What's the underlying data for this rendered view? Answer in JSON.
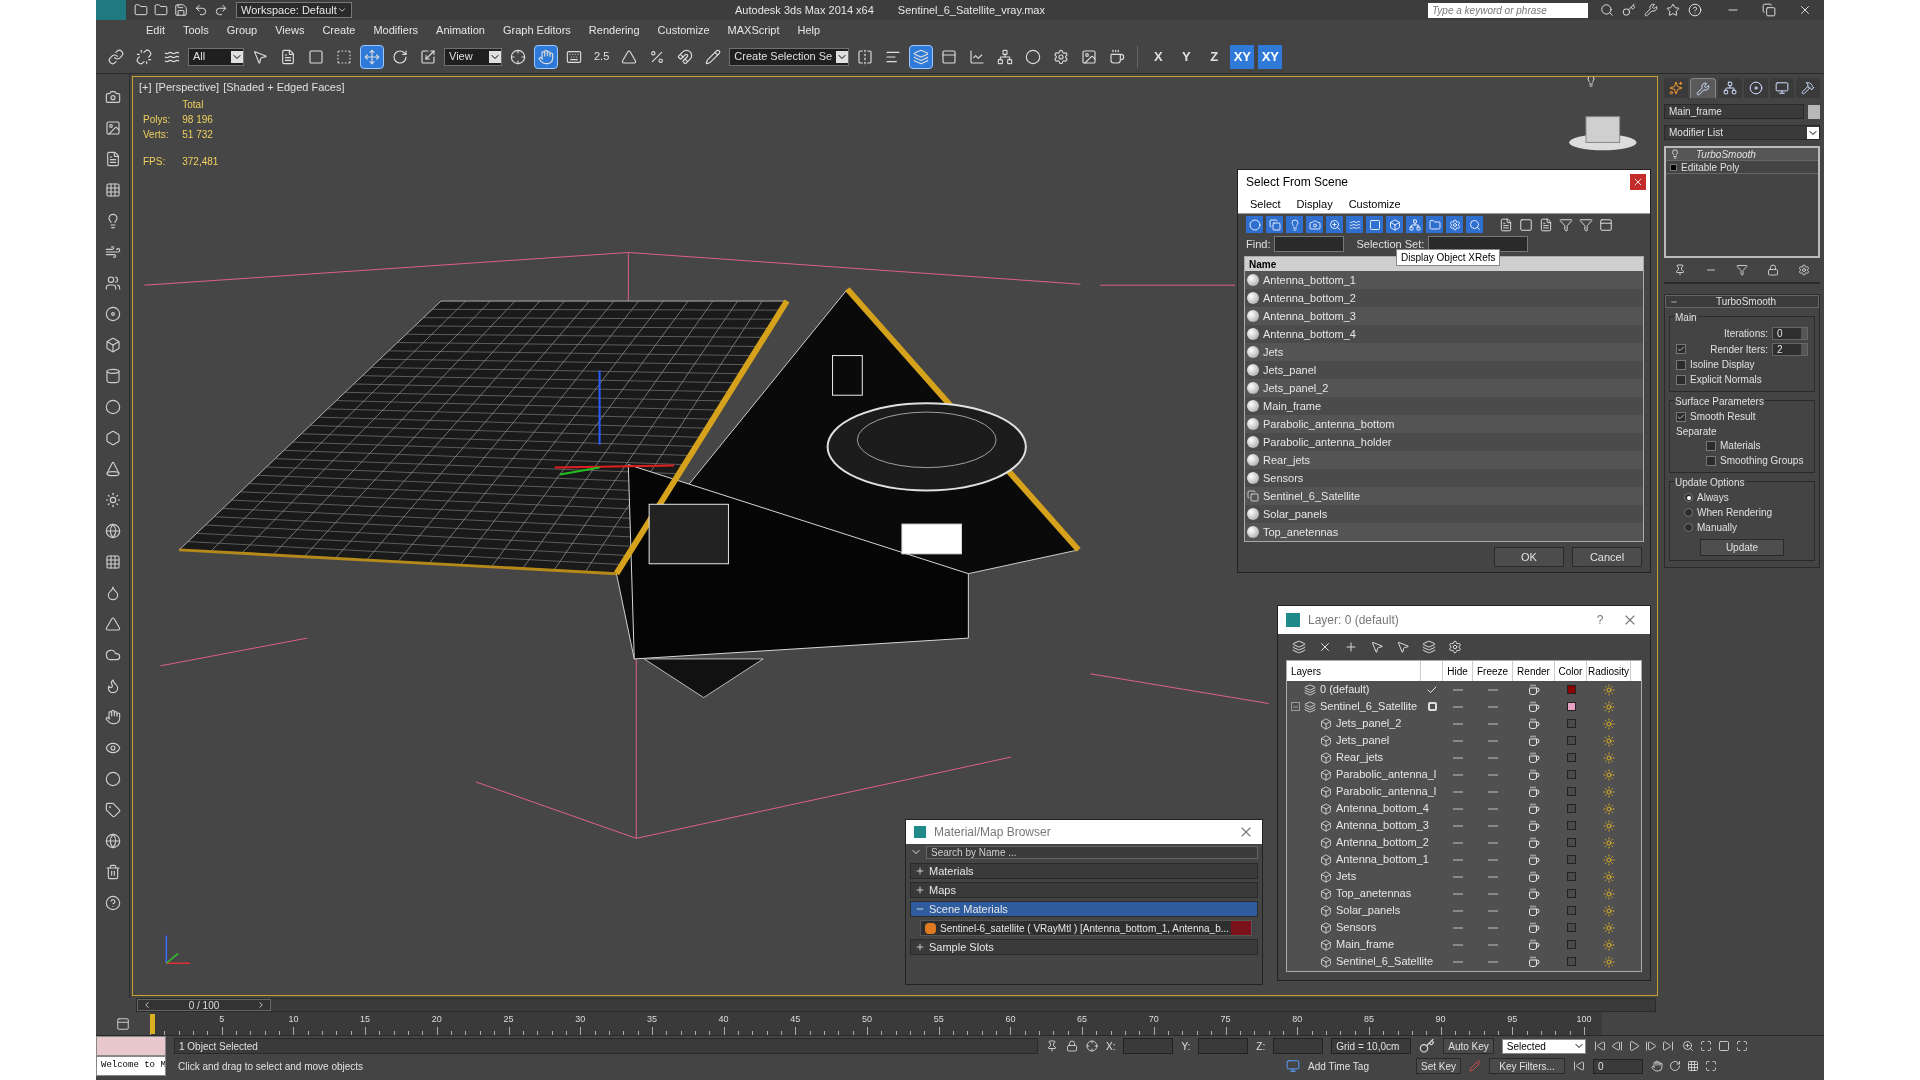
{
  "title_bar": {
    "workspace": "Workspace: Default",
    "app_title": "Autodesk 3ds Max  2014 x64",
    "file_name": "Sentinel_6_Satellite_vray.max",
    "search": {
      "placeholder": "Type a keyword or phrase"
    }
  },
  "menu": [
    "Edit",
    "Tools",
    "Group",
    "Views",
    "Create",
    "Modifiers",
    "Animation",
    "Graph Editors",
    "Rendering",
    "Customize",
    "MAXScript",
    "Help"
  ],
  "main_toolbar": {
    "selection_filter": "All",
    "reference_coord": "View",
    "snap_label": "2.5",
    "named_selection": "Create Selection Se",
    "tools": [
      {
        "selected": false
      },
      {
        "selected": false
      },
      {
        "selected": false
      },
      {
        "selected": false
      },
      {
        "selected": false
      },
      {
        "selected": false
      },
      {
        "selected": false
      },
      {
        "selected": true
      },
      {
        "selected": false
      },
      {
        "selected": false
      },
      {
        "selected": false
      },
      {
        "selected": true
      },
      {
        "selected": false
      },
      {
        "selected": false
      },
      {
        "selected": false
      },
      {
        "selected": false
      },
      {
        "selected": false
      },
      {
        "selected": false
      },
      {
        "selected": false
      },
      {
        "selected": true
      },
      {
        "selected": false
      },
      {
        "selected": false
      },
      {
        "selected": false
      },
      {
        "selected": false
      },
      {
        "selected": false
      },
      {
        "selected": false
      },
      {
        "selected": false
      }
    ],
    "axes": [
      {
        "label": "X",
        "selected": false
      },
      {
        "label": "Y",
        "selected": false
      },
      {
        "label": "Z",
        "selected": false
      },
      {
        "label": "XY",
        "selected": true
      },
      {
        "label": "XY",
        "selected": true
      }
    ]
  },
  "viewport": {
    "labels": [
      "[+]",
      "[Perspective]",
      "[Shaded + Edged Faces]"
    ],
    "stats": {
      "heading": "Total",
      "rows": [
        {
          "label": "Polys:",
          "value": "98 196"
        },
        {
          "label": "Verts:",
          "value": "51 732"
        }
      ],
      "fps": {
        "label": "FPS:",
        "value": "372,481"
      }
    }
  },
  "select_from_scene": {
    "title": "Select From Scene",
    "menu": [
      "Select",
      "Display",
      "Customize"
    ],
    "find_label": "Find:",
    "selection_set_label": "Selection Set:",
    "tooltip": "Display Object XRefs",
    "column": "Name",
    "rows": [
      {
        "name": "Antenna_bottom_1",
        "kind": "object"
      },
      {
        "name": "Antenna_bottom_2",
        "kind": "object"
      },
      {
        "name": "Antenna_bottom_3",
        "kind": "object"
      },
      {
        "name": "Antenna_bottom_4",
        "kind": "object"
      },
      {
        "name": "Jets",
        "kind": "object"
      },
      {
        "name": "Jets_panel",
        "kind": "object"
      },
      {
        "name": "Jets_panel_2",
        "kind": "object"
      },
      {
        "name": "Main_frame",
        "kind": "object"
      },
      {
        "name": "Parabolic_antenna_bottom",
        "kind": "object"
      },
      {
        "name": "Parabolic_antenna_holder",
        "kind": "object"
      },
      {
        "name": "Rear_jets",
        "kind": "object"
      },
      {
        "name": "Sensors",
        "kind": "object"
      },
      {
        "name": "Sentinel_6_Satellite",
        "kind": "group"
      },
      {
        "name": "Solar_panels",
        "kind": "object"
      },
      {
        "name": "Top_anetennas",
        "kind": "object"
      }
    ],
    "buttons": [
      "OK",
      "Cancel"
    ]
  },
  "layer_explorer": {
    "title": "Layer: 0 (default)",
    "help": "?",
    "columns": [
      "Layers",
      "Hide",
      "Freeze",
      "Render",
      "Color",
      "Radiosity"
    ],
    "layers": [
      {
        "name": "0 (default)",
        "current": true,
        "color": "#8b0000"
      },
      {
        "name": "Sentinel_6_Satellite",
        "current": false,
        "expanded": true,
        "color": "#e8a0c0",
        "children": [
          {
            "name": "Jets_panel_2"
          },
          {
            "name": "Jets_panel"
          },
          {
            "name": "Rear_jets"
          },
          {
            "name": "Parabolic_antenna_l"
          },
          {
            "name": "Parabolic_antenna_l"
          },
          {
            "name": "Antenna_bottom_4"
          },
          {
            "name": "Antenna_bottom_3"
          },
          {
            "name": "Antenna_bottom_2"
          },
          {
            "name": "Antenna_bottom_1"
          },
          {
            "name": "Jets"
          },
          {
            "name": "Top_anetennas"
          },
          {
            "name": "Solar_panels"
          },
          {
            "name": "Sensors"
          },
          {
            "name": "Main_frame"
          },
          {
            "name": "Sentinel_6_Satellite"
          }
        ]
      }
    ]
  },
  "material_browser": {
    "title": "Material/Map Browser",
    "search": {
      "placeholder": "Search by Name ..."
    },
    "groups": [
      {
        "label": "Materials",
        "expanded": false,
        "selected": false
      },
      {
        "label": "Maps",
        "expanded": false,
        "selected": false
      },
      {
        "label": "Scene Materials",
        "expanded": true,
        "selected": true,
        "items": [
          "Sentinel-6_satellite  ( VRayMtl ) [Antenna_bottom_1, Antenna_b..."
        ]
      },
      {
        "label": "Sample Slots",
        "expanded": false,
        "selected": false
      }
    ]
  },
  "command_panel": {
    "tabs": [
      {
        "selected": false
      },
      {
        "selected": true
      },
      {
        "selected": false
      },
      {
        "selected": false
      },
      {
        "selected": false
      },
      {
        "selected": false
      }
    ],
    "object_name": "Main_frame",
    "modifier_list": "Modifier List",
    "stack": [
      {
        "label": "TurboSmooth",
        "kind": "modifier"
      },
      {
        "label": "Editable Poly",
        "kind": "base"
      }
    ],
    "rollout": {
      "title": "TurboSmooth",
      "groups": [
        {
          "title": "Main",
          "items": [
            {
              "kind": "spinner",
              "label": "Iterations:",
              "value": "0"
            },
            {
              "kind": "checkspinner",
              "label": "Render Iters:",
              "value": "2",
              "checked": true
            },
            {
              "kind": "checkbox",
              "label": "Isoline Display",
              "checked": false
            },
            {
              "kind": "checkbox",
              "label": "Explicit Normals",
              "checked": false
            }
          ]
        },
        {
          "title": "Surface Parameters",
          "items": [
            {
              "kind": "checkbox",
              "label": "Smooth Result",
              "checked": true
            },
            {
              "kind": "heading",
              "label": "Separate",
              "children": [
                {
                  "kind": "checkbox",
                  "label": "Materials",
                  "checked": false
                },
                {
                  "kind": "checkbox",
                  "label": "Smoothing Groups",
                  "checked": false
                }
              ]
            }
          ]
        },
        {
          "title": "Update Options",
          "items": [
            {
              "kind": "radio",
              "label": "Always",
              "selected": true
            },
            {
              "kind": "radio",
              "label": "When Rendering",
              "selected": false
            },
            {
              "kind": "radio",
              "label": "Manually",
              "selected": false
            },
            {
              "kind": "button",
              "label": "Update"
            }
          ]
        }
      ]
    }
  },
  "time_slider": {
    "position": "0 / 100",
    "level": 0
  },
  "track_ruler": {
    "ticks": [
      "5",
      "10",
      "15",
      "20",
      "25",
      "30",
      "35",
      "40",
      "45",
      "50",
      "55",
      "60",
      "65",
      "70",
      "75",
      "80",
      "85",
      "90",
      "95",
      "100"
    ]
  },
  "status_bar": {
    "listener": "Welcome to M",
    "selection_info": "1 Object Selected",
    "prompt": "Click and drag to select and move objects",
    "coords": [
      "X:",
      "Y:",
      "Z:"
    ],
    "grid": "Grid = 10,0cm",
    "add_time_tag": "Add Time Tag",
    "auto_key": "Auto Key",
    "key_mode": "Selected",
    "set_key": "Set Key",
    "key_filters": "Key Filters...",
    "current_frame": "0"
  }
}
